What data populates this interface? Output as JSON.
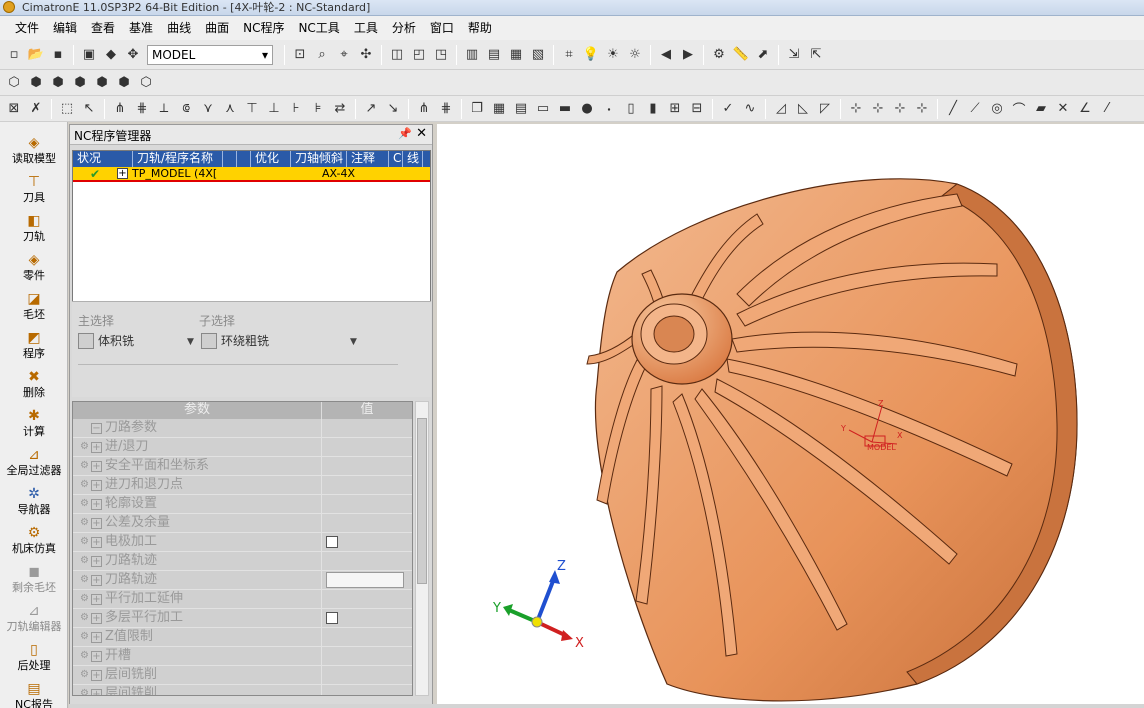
{
  "window": {
    "title": "CimatronE 11.0SP3P2 64-Bit Edition - [4X-叶轮-2 : NC-Standard]"
  },
  "menu": [
    "文件",
    "编辑",
    "查看",
    "基准",
    "曲线",
    "曲面",
    "NC程序",
    "NC工具",
    "工具",
    "分析",
    "窗口",
    "帮助"
  ],
  "toolbar": {
    "model_select_value": "MODEL"
  },
  "sidebar": {
    "items": [
      {
        "label": "读取模型",
        "icon": "open-model-icon",
        "enabled": true
      },
      {
        "label": "刀具",
        "icon": "tool-icon",
        "enabled": true
      },
      {
        "label": "刀轨",
        "icon": "toolpath-icon",
        "enabled": true
      },
      {
        "label": "零件",
        "icon": "part-icon",
        "enabled": true
      },
      {
        "label": "毛坯",
        "icon": "stock-icon",
        "enabled": true
      },
      {
        "label": "程序",
        "icon": "procedure-icon",
        "enabled": true
      },
      {
        "label": "删除",
        "icon": "delete-icon",
        "enabled": true
      },
      {
        "label": "计算",
        "icon": "calculate-icon",
        "enabled": true
      },
      {
        "label": "全局过滤器",
        "icon": "filter-icon",
        "enabled": true
      },
      {
        "label": "导航器",
        "icon": "navigator-icon",
        "enabled": true
      },
      {
        "label": "机床仿真",
        "icon": "simulation-icon",
        "enabled": true
      },
      {
        "label": "剩余毛坯",
        "icon": "remaining-stock-icon",
        "enabled": false
      },
      {
        "label": "刀轨编辑器",
        "icon": "toolpath-editor-icon",
        "enabled": false
      },
      {
        "label": "后处理",
        "icon": "post-process-icon",
        "enabled": true
      },
      {
        "label": "NC报告",
        "icon": "nc-report-icon",
        "enabled": true
      }
    ]
  },
  "nc_panel": {
    "title": "NC程序管理器",
    "columns": [
      "状况",
      "刀轨/程序名称",
      "",
      "",
      "优化",
      "刀轴倾斜",
      "注释",
      "C",
      "线"
    ],
    "rows": [
      {
        "name": "TP_MODEL (4X[",
        "note": "AX-4X"
      }
    ],
    "main_select_label": "主选择",
    "main_select_value": "体积铣",
    "sub_select_label": "子选择",
    "sub_select_value": "环绕粗铣",
    "grid_headers": [
      "参数",
      "值"
    ],
    "params": [
      {
        "label": "刀路参数",
        "top": true,
        "value": ""
      },
      {
        "label": "进/退刀",
        "value": ""
      },
      {
        "label": "安全平面和坐标系",
        "value": ""
      },
      {
        "label": "进刀和退刀点",
        "value": ""
      },
      {
        "label": "轮廓设置",
        "value": ""
      },
      {
        "label": "公差及余量",
        "value": ""
      },
      {
        "label": "电极加工",
        "value": "checkbox"
      },
      {
        "label": "刀路轨迹",
        "value": ""
      },
      {
        "label": "刀路轨迹",
        "value": "field"
      },
      {
        "label": "平行加工延伸",
        "value": ""
      },
      {
        "label": "多层平行加工",
        "value": "checkbox"
      },
      {
        "label": "Z值限制",
        "value": ""
      },
      {
        "label": "开槽",
        "value": ""
      },
      {
        "label": "层间铣削",
        "value": ""
      },
      {
        "label": "层间铣削",
        "value": ""
      }
    ]
  },
  "viewport": {
    "model_label": "MODEL",
    "csys_label_x": "X",
    "csys_label_y": "Y",
    "csys_label_z": "Z",
    "triad": {
      "x": "X",
      "y": "Y",
      "z": "Z"
    },
    "colors": {
      "part": "#e8935a",
      "edge": "#5a2a10"
    }
  }
}
